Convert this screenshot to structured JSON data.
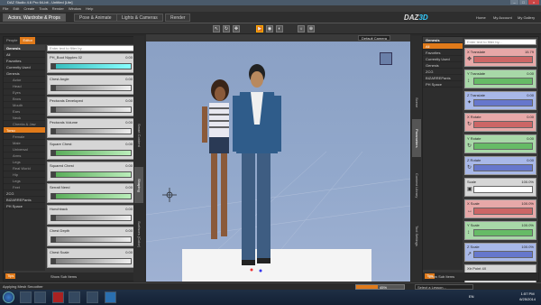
{
  "window": {
    "title": "DAZ Studio 4.6 Pro 64-bit - Untitled [Lite]"
  },
  "menu": [
    "File",
    "Edit",
    "Create",
    "Tools",
    "Render",
    "Window",
    "Help"
  ],
  "rooms": [
    "Actors, Wardrobe & Props",
    "Pose & Animate",
    "Lights & Cameras",
    "Render"
  ],
  "header_links": [
    "Home",
    "My Account",
    "My Gallery"
  ],
  "left_panel": {
    "tabs": [
      "People",
      "Editor"
    ],
    "search_placeholder": "Enter text to filter by...",
    "categories": [
      "Genesis",
      "All",
      "Favorites",
      "Currently Used",
      "Genesis",
      "Actor",
      "Head",
      "Eyes",
      "Brow",
      "Mouth",
      "Ears",
      "Neck",
      "Cheeks & Jaw",
      "Torso",
      "Female",
      "Male",
      "Universal",
      "Arms",
      "Legs",
      "Real World",
      "Hip",
      "Legs",
      "Feet",
      "ZCG",
      "BIZARREPants",
      "PH Space"
    ],
    "sliders": [
      {
        "label": "PH_Boot Nipples 02",
        "value": "0.00",
        "style": "cyan"
      },
      {
        "label": "Chest Angle",
        "value": "0.00",
        "style": "gray"
      },
      {
        "label": "Pectorals Developed",
        "value": "0.00",
        "style": "gray"
      },
      {
        "label": "Pectorals Volume",
        "value": "0.00",
        "style": "gray"
      },
      {
        "label": "Square Chest",
        "value": "0.00",
        "style": "green"
      },
      {
        "label": "Squared Chest",
        "value": "0.00",
        "style": "green"
      },
      {
        "label": "Serratl Need",
        "value": "0.00",
        "style": "green"
      },
      {
        "label": "Hunchback",
        "value": "0.00",
        "style": "gray"
      },
      {
        "label": "Chest Depth",
        "value": "0.00",
        "style": "gray"
      },
      {
        "label": "Chest Scale",
        "value": "0.00",
        "style": "gray"
      }
    ],
    "footer_chip": "Tips",
    "footer_text": "Show Sub Items"
  },
  "left_vtabs": [
    "Smart Content",
    "Shaping",
    "Surfaces (Color)"
  ],
  "viewport": {
    "camera": "Default Camera"
  },
  "right_vtabs": [
    "Scene",
    "Parameters",
    "Content Library",
    "Tool Settings"
  ],
  "right_panel": {
    "categories": [
      "Genesis",
      "All",
      "Favorites",
      "Currently Used",
      "Genesis",
      "ZCG",
      "BIZARREPants",
      "PH Space"
    ],
    "search_placeholder": "Enter text to filter by...",
    "sliders": [
      {
        "label": "X Translate",
        "value": "15.79",
        "color": "red",
        "icon": "✥"
      },
      {
        "label": "Y Translate",
        "value": "0.00",
        "color": "grn",
        "icon": "↕"
      },
      {
        "label": "Z Translate",
        "value": "0.00",
        "color": "blu",
        "icon": "✦"
      },
      {
        "label": "X Rotate",
        "value": "0.00",
        "color": "red",
        "icon": "↻"
      },
      {
        "label": "Y Rotate",
        "value": "0.00",
        "color": "grn",
        "icon": "↻"
      },
      {
        "label": "Z Rotate",
        "value": "0.00",
        "color": "blu",
        "icon": "↻"
      },
      {
        "label": "Scale",
        "value": "100.0%",
        "color": "wht",
        "icon": "▣"
      },
      {
        "label": "X Scale",
        "value": "100.0%",
        "color": "red",
        "icon": "↔"
      },
      {
        "label": "Y Scale",
        "value": "100.0%",
        "color": "grn",
        "icon": "↕"
      },
      {
        "label": "Z Scale",
        "value": "100.0%",
        "color": "blu",
        "icon": "↗"
      },
      {
        "label": "Xtr Point 4X",
        "value": "",
        "color": "wht",
        "icon": "•"
      }
    ],
    "footer_chip": "Tips",
    "footer_text": "Show Sub Items"
  },
  "status": {
    "message": "Applying Mesh Smoother",
    "progress_percent": 45,
    "progress_label": "45%",
    "lesson": "Select a Lesson..."
  },
  "taskbar": {
    "lang": "EN",
    "time": "1:57 PM",
    "date": "6/25/2014"
  },
  "colors": {
    "accent": "#e07a1a",
    "viewport_bg": "#93a9cc"
  }
}
